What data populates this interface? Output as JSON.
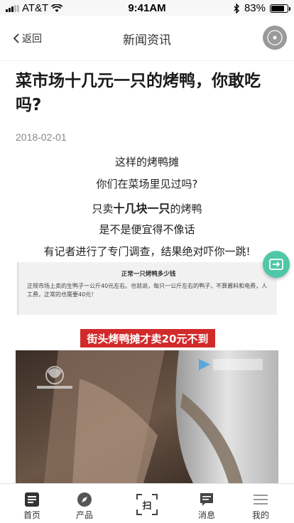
{
  "status_bar": {
    "carrier": "AT&T",
    "time": "9:41AM",
    "battery": "83%",
    "battery_level": 0.83
  },
  "nav": {
    "back_label": "返回",
    "title": "新闻资讯"
  },
  "article": {
    "headline": "菜市场十几元一只的烤鸭，你敢吃吗?",
    "date": "2018-02-01",
    "paragraphs": {
      "p1": "这样的烤鸭摊",
      "p2": "你们在菜场里见过吗?",
      "p3_pre": "只卖",
      "p3_bold": "十几块一只",
      "p3_post": "的烤鸭",
      "p4": "是不是便宜得不像话",
      "p5": "有记者进行了专门调查，结果绝对吓你一跳!"
    },
    "quote": {
      "title": "正常一只烤鸭多少钱",
      "text": "正规市场上卖的生鸭子一公斤40元左右。也就说，每只一公斤左右的鸭子，不算酱料和电费，人工费，正常的也需要40元！"
    },
    "banner": "街头烤鸭摊才卖20元不到"
  },
  "tabs": [
    {
      "label": "首页",
      "icon": "news-icon"
    },
    {
      "label": "产品",
      "icon": "compass-icon"
    },
    {
      "label": "扫",
      "icon": "scan-icon"
    },
    {
      "label": "消息",
      "icon": "message-icon"
    },
    {
      "label": "我的",
      "icon": "menu-icon"
    }
  ],
  "colors": {
    "accent_green": "#4fc7a8",
    "banner_red": "#d12a2a",
    "disc_gray": "#9a9a9a"
  }
}
